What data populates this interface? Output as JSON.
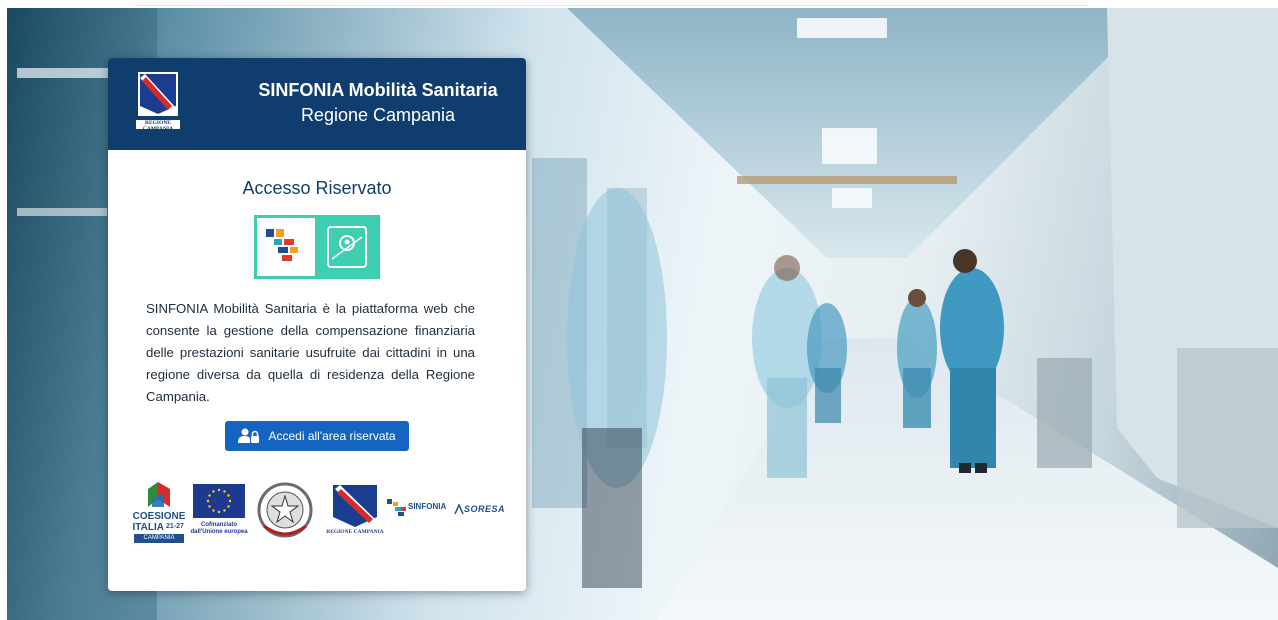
{
  "header": {
    "title": "SINFONIA Mobilità Sanitaria",
    "subtitle": "Regione Campania",
    "crest_caption": "REGIONE CAMPANIA"
  },
  "login": {
    "title": "Accesso Riservato",
    "description": "SINFONIA Mobilità Sanitaria è la piattaforma web che consente la gestione della compensazione finanziaria delle prestazioni sanitarie usufruite dai cittadini in una regione diversa da quella di residenza della Regione Campania.",
    "button_label": "Accedi all'area riservata"
  },
  "partners": {
    "coesione": {
      "line1": "COESIONE",
      "line2": "ITALIA",
      "years": "21-27",
      "tag": "CAMPANIA"
    },
    "eu": {
      "line1": "Cofinanziato",
      "line2": "dall'Unione europea"
    },
    "campania_caption": "REGIONE CAMPANIA",
    "sinfonia_label": "SINFONIA",
    "soresa_label": "SORESA"
  },
  "icons": {
    "crest": "regione-campania-crest-icon",
    "app": "sinfonia-mobility-app-icon",
    "button": "user-lock-icon",
    "italy": "italian-republic-emblem-icon"
  },
  "colors": {
    "header_bg": "#0f3e6e",
    "button_bg": "#1565c0",
    "app_icon_teal": "#3ecfb2"
  }
}
